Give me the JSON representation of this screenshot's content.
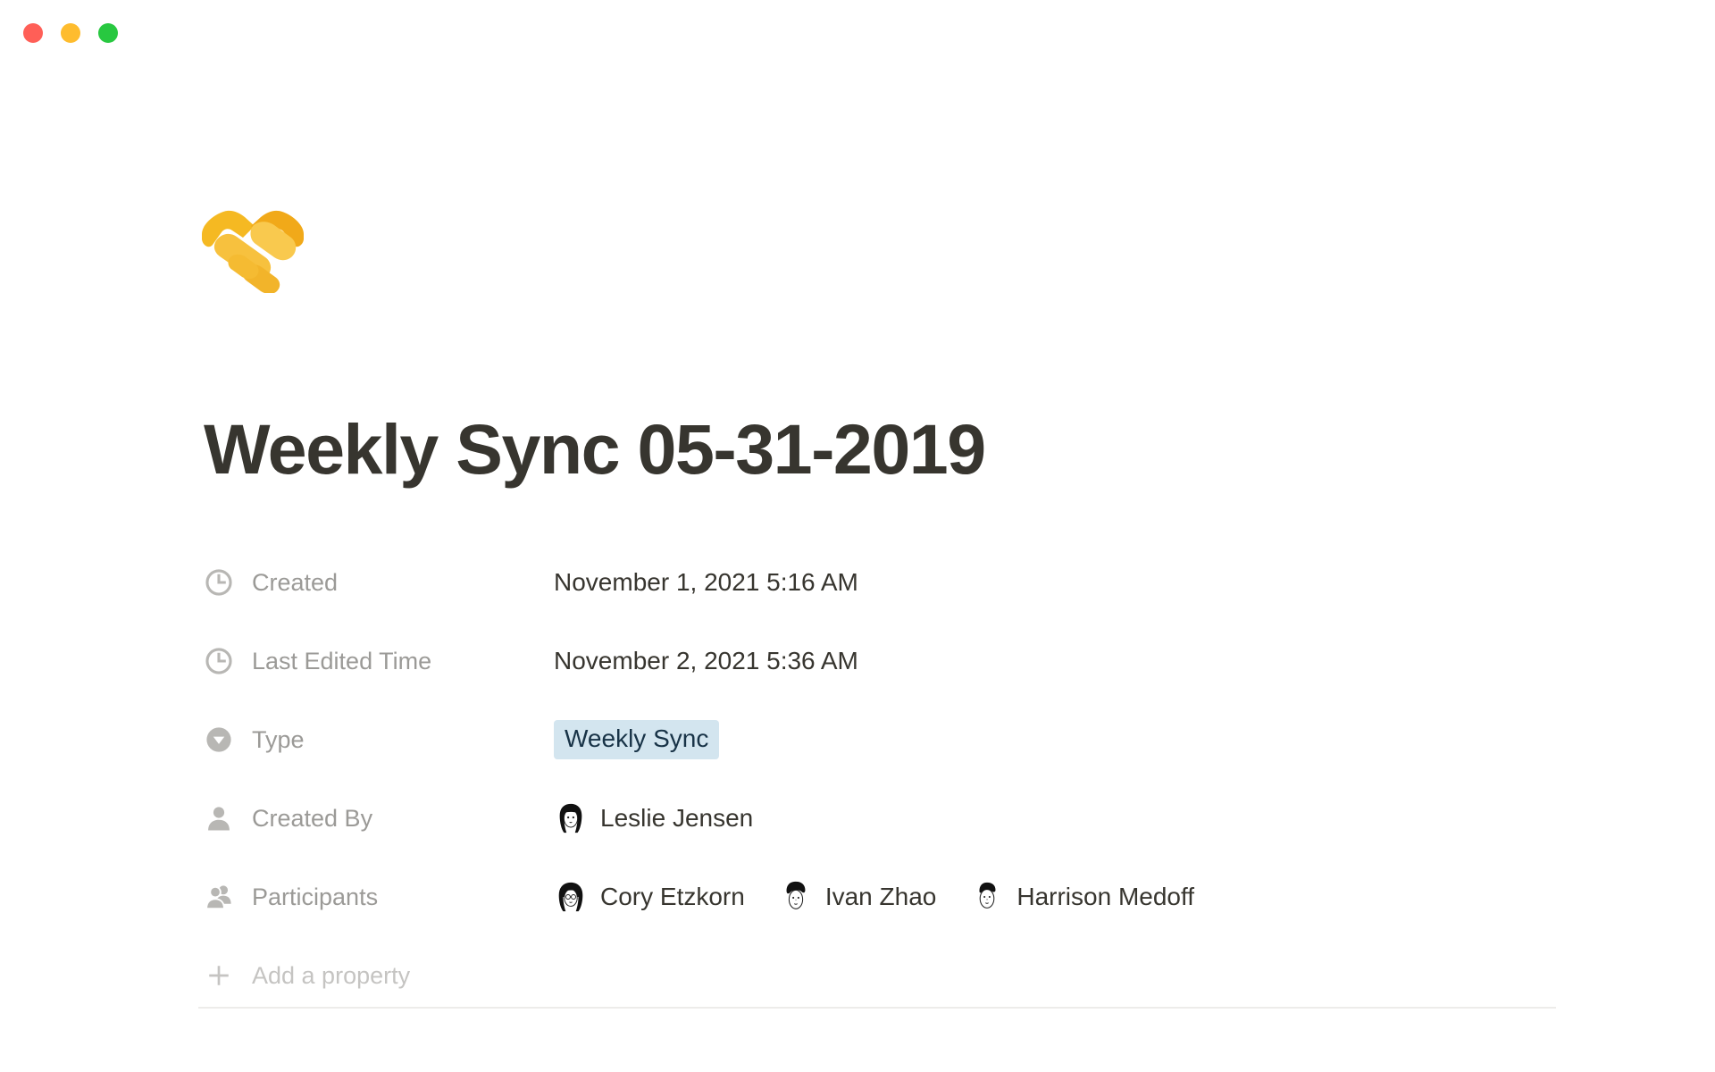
{
  "window": {
    "traffic_lights": [
      {
        "name": "close",
        "color": "#FF5F57"
      },
      {
        "name": "minimize",
        "color": "#FEBC2E"
      },
      {
        "name": "maximize",
        "color": "#28C840"
      }
    ]
  },
  "page": {
    "emoji": "🤝",
    "emoji_name": "handshake-emoji",
    "title": "Weekly Sync 05-31-2019",
    "add_property_label": "Add a property",
    "add_property_icon": "plus-icon"
  },
  "properties": [
    {
      "label": "Created",
      "icon": "clock-icon",
      "type": "date",
      "value": "November 1, 2021 5:16 AM"
    },
    {
      "label": "Last Edited Time",
      "icon": "clock-icon",
      "type": "date",
      "value": "November 2, 2021 5:36 AM"
    },
    {
      "label": "Type",
      "icon": "select-chevron-icon",
      "type": "select",
      "value": "Weekly Sync",
      "badge_bg": "#D3E5EF",
      "badge_color": "#183347"
    },
    {
      "label": "Created By",
      "icon": "person-icon",
      "type": "person",
      "people": [
        {
          "name": "Leslie Jensen",
          "avatar": "long-dark-hair-face-avatar"
        }
      ]
    },
    {
      "label": "Participants",
      "icon": "people-icon",
      "type": "people",
      "people": [
        {
          "name": "Cory Etzkorn",
          "avatar": "glasses-long-hair-face-avatar"
        },
        {
          "name": "Ivan Zhao",
          "avatar": "curly-hair-face-avatar"
        },
        {
          "name": "Harrison Medoff",
          "avatar": "short-hair-face-avatar"
        }
      ]
    }
  ]
}
